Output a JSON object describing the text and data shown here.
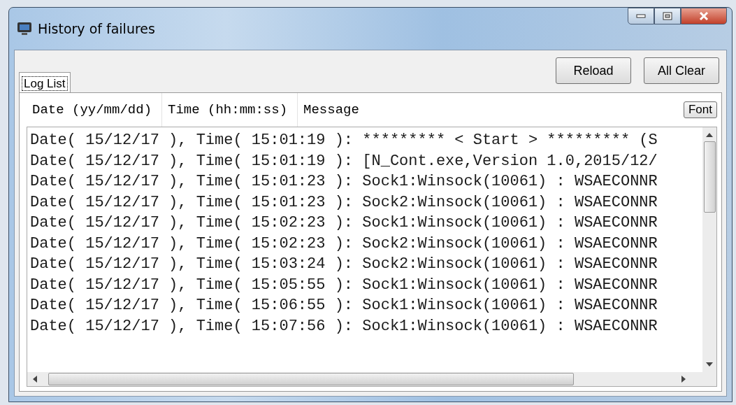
{
  "window": {
    "title": "History of failures"
  },
  "tabs": [
    {
      "label": "Log List",
      "selected": true
    }
  ],
  "buttons": [
    "Reload",
    "All Clear"
  ],
  "columns": [
    "Date (yy/mm/dd)",
    "Time (hh:mm:ss)",
    "Message"
  ],
  "font_button": "Font",
  "rows": [
    {
      "text": "Date( 15/12/17 ), Time( 15:01:19 ): ********* < Start > ********* (S"
    },
    {
      "text": "Date( 15/12/17 ), Time( 15:01:19 ): [N_Cont.exe,Version 1.0,2015/12/"
    },
    {
      "text": "Date( 15/12/17 ), Time( 15:01:23 ): Sock1:Winsock(10061) : WSAECONNR"
    },
    {
      "text": "Date( 15/12/17 ), Time( 15:01:23 ): Sock2:Winsock(10061) : WSAECONNR"
    },
    {
      "text": "Date( 15/12/17 ), Time( 15:02:23 ): Sock1:Winsock(10061) : WSAECONNR"
    },
    {
      "text": "Date( 15/12/17 ), Time( 15:02:23 ): Sock2:Winsock(10061) : WSAECONNR"
    },
    {
      "text": "Date( 15/12/17 ), Time( 15:03:24 ): Sock2:Winsock(10061) : WSAECONNR"
    },
    {
      "text": "Date( 15/12/17 ), Time( 15:05:55 ): Sock1:Winsock(10061) : WSAECONNR"
    },
    {
      "text": "Date( 15/12/17 ), Time( 15:06:55 ): Sock1:Winsock(10061) : WSAECONNR"
    },
    {
      "text": "Date( 15/12/17 ), Time( 15:07:56 ): Sock1:Winsock(10061) : WSAECONNR"
    }
  ]
}
